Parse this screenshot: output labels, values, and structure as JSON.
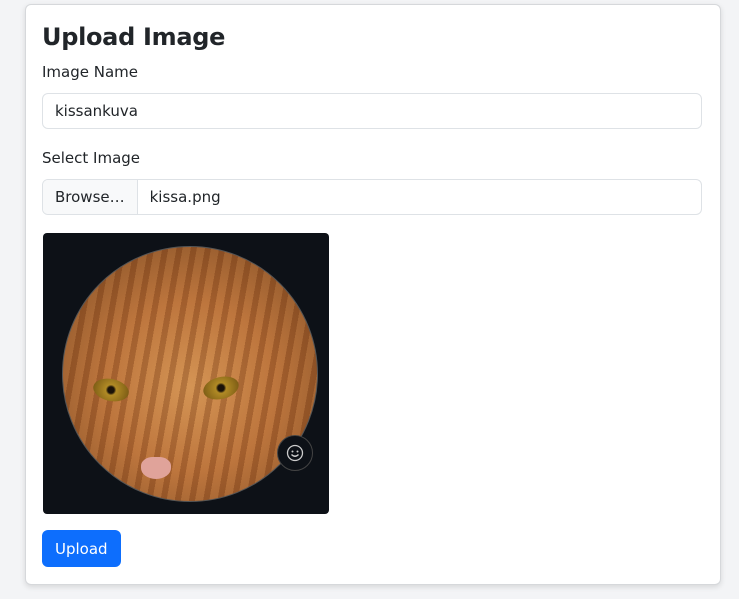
{
  "title": "Upload Image",
  "image_name": {
    "label": "Image Name",
    "value": "kissankuva"
  },
  "select_image": {
    "label": "Select Image",
    "browse_label": "Browse…",
    "file_name": "kissa.png"
  },
  "preview": {
    "emoji_icon": "smiley-icon"
  },
  "upload_label": "Upload",
  "colors": {
    "primary": "#0d6efd",
    "preview_bg": "#0d1117"
  }
}
